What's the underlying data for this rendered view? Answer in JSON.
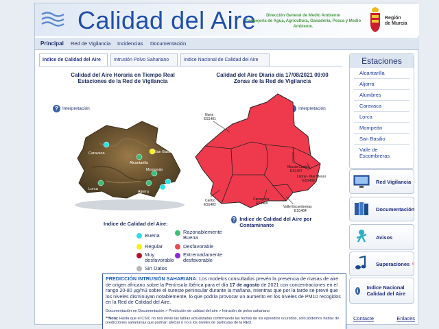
{
  "header": {
    "title": "Calidad del Aire",
    "dg_line1": "Dirección General de Medio Ambiente",
    "dg_line2": "Consejería de Agua, Agricultura, Ganadería, Pesca y Medio Ambiente.",
    "region_line1": "Región",
    "region_line2": "de Murcia"
  },
  "mainnav": [
    "Principal",
    "Red de Vigilancia",
    "Incidencias",
    "Documentación"
  ],
  "tabs": [
    "Indice de Calidad del Aire",
    "Intrusión Polvo Sahariano",
    "Indice Nacional de Calidad del Aire"
  ],
  "left_map": {
    "title_line1": "Calidad del Aire Horaria en Tiempo Real",
    "title_line2": "Estaciones de la Red de Vigilancia",
    "interp": "Interpretación",
    "labels": [
      "Caravaca",
      "San Basilio",
      "Alcantarilla",
      "Lorca",
      "Alumbres",
      "Mompeán",
      "Aljorra",
      "Valle Escombreras"
    ]
  },
  "right_map": {
    "title_line1": "Calidad del Aire Diaria día 17/08/2021 09:00",
    "title_line2": "Zonas de la Red de Vigilancia",
    "interp": "Interpretación",
    "zones": [
      {
        "name": "Norte",
        "code": "ES1401"
      },
      {
        "name": "Murcia Ciudad",
        "code": "ES1407"
      },
      {
        "name": "Litoral - Mar Menor",
        "code": "ES1408"
      },
      {
        "name": "Centro",
        "code": "ES1402"
      },
      {
        "name": "Cartagena",
        "code": "ES1406"
      },
      {
        "name": "Valle Escombreras",
        "code": "ES1404"
      }
    ],
    "zone_color": "#ee3a4c"
  },
  "legend": {
    "title": "Indice de Calidad del Aire:",
    "items": [
      {
        "label": "Buena",
        "color": "#2de0e0"
      },
      {
        "label": "Razonablemente Buena",
        "color": "#3bbf7a"
      },
      {
        "label": "Regular",
        "color": "#f4f01c"
      },
      {
        "label": "Desfavorable",
        "color": "#f0484e"
      },
      {
        "label": "Muy desfavorable",
        "color": "#b0142c"
      },
      {
        "label": "Extremadamente desfavorable",
        "color": "#8a2ad8"
      },
      {
        "label": "Sin Datos",
        "color": "#b8b8b8"
      }
    ]
  },
  "ica_link": "Indice de Calidad del Aire por Contaminante",
  "prediction": {
    "title": "PREDICCIÓN INTRUSIÓN SAHARIANA:",
    "text1": " Los modelos consultados prevén la presencia de masas de aire de origen africano sobre la Península Ibérica para el día ",
    "date": "17 de agosto",
    "text2": " de 2021 con concentraciones en el rango 20-80 µg/m3 sobre el sureste peninsular durante la mañana, mientras que por la tarde se prevé que los niveles disminuyan notablemente, lo que podría provocar un aumento en los niveles de PM10 recogidos en la Red de Calidad del Aire.",
    "breadcrumb": "Documentación en Documentación > Predicción de calidad del aire > Intrusión de polvo sahariano",
    "note_bold": "**Nota:",
    "note": " Hasta que el CSIC no nos envíe las tablas actualizadas confirmando las fechas de los episodios ocurridos, sólo podemos hablar de predicciones saharianas que podrían afectar o no a los niveles de partículas de la RED."
  },
  "stations": {
    "title": "Estaciones",
    "items": [
      "Alcantarilla",
      "Aljorra",
      "Alumbres",
      "Caravaca",
      "Lorca",
      "Mompeán",
      "San Basilio",
      "Valle de Escombreras"
    ]
  },
  "side_buttons": [
    "Red Vigilancia",
    "Documentación",
    "Avisos",
    "Superaciones",
    "Indice Nacional Calidad del Aire"
  ],
  "footer": [
    "Contacte",
    "Enlaces"
  ],
  "colors": {
    "brand": "#1f4fa8",
    "nav_bg": "#dce5f0"
  }
}
